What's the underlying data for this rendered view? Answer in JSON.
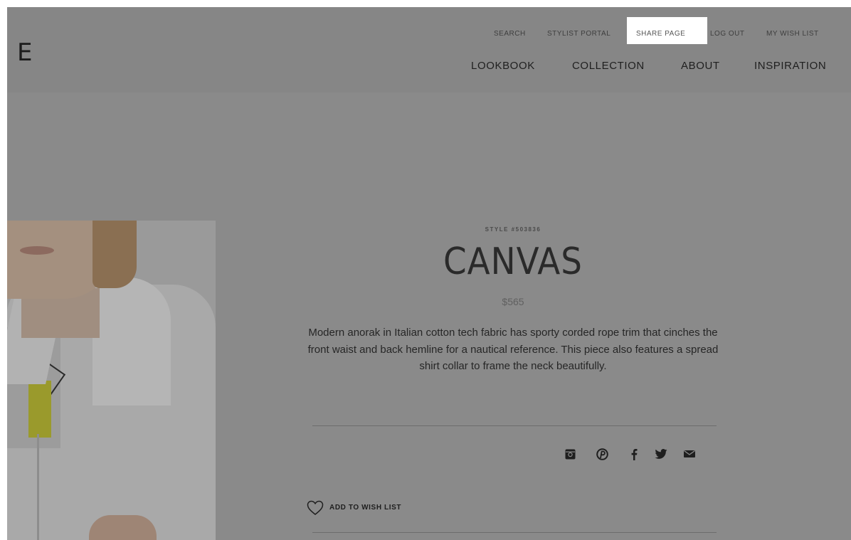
{
  "header": {
    "logo": "E",
    "utility_nav": [
      "SEARCH",
      "STYLIST PORTAL",
      "SHARE PAGE",
      "LOG OUT",
      "MY WISH LIST"
    ],
    "main_nav": [
      "LOOKBOOK",
      "COLLECTION",
      "ABOUT",
      "INSPIRATION"
    ]
  },
  "product": {
    "style_number": "STYLE #503836",
    "name": "CANVAS",
    "price": "$565",
    "description": "Modern anorak in Italian cotton tech fabric has sporty corded rope trim that cinches the front waist and back hemline for a nautical reference. This piece also features a spread shirt collar to frame the neck beautifully.",
    "social_icons": [
      "instagram-icon",
      "pinterest-icon",
      "facebook-icon",
      "twitter-icon",
      "email-icon"
    ],
    "wish_list_label": "ADD TO WISH LIST"
  },
  "colors": {
    "overlay": "#8a8a8a",
    "highlight": "#ffffff"
  }
}
